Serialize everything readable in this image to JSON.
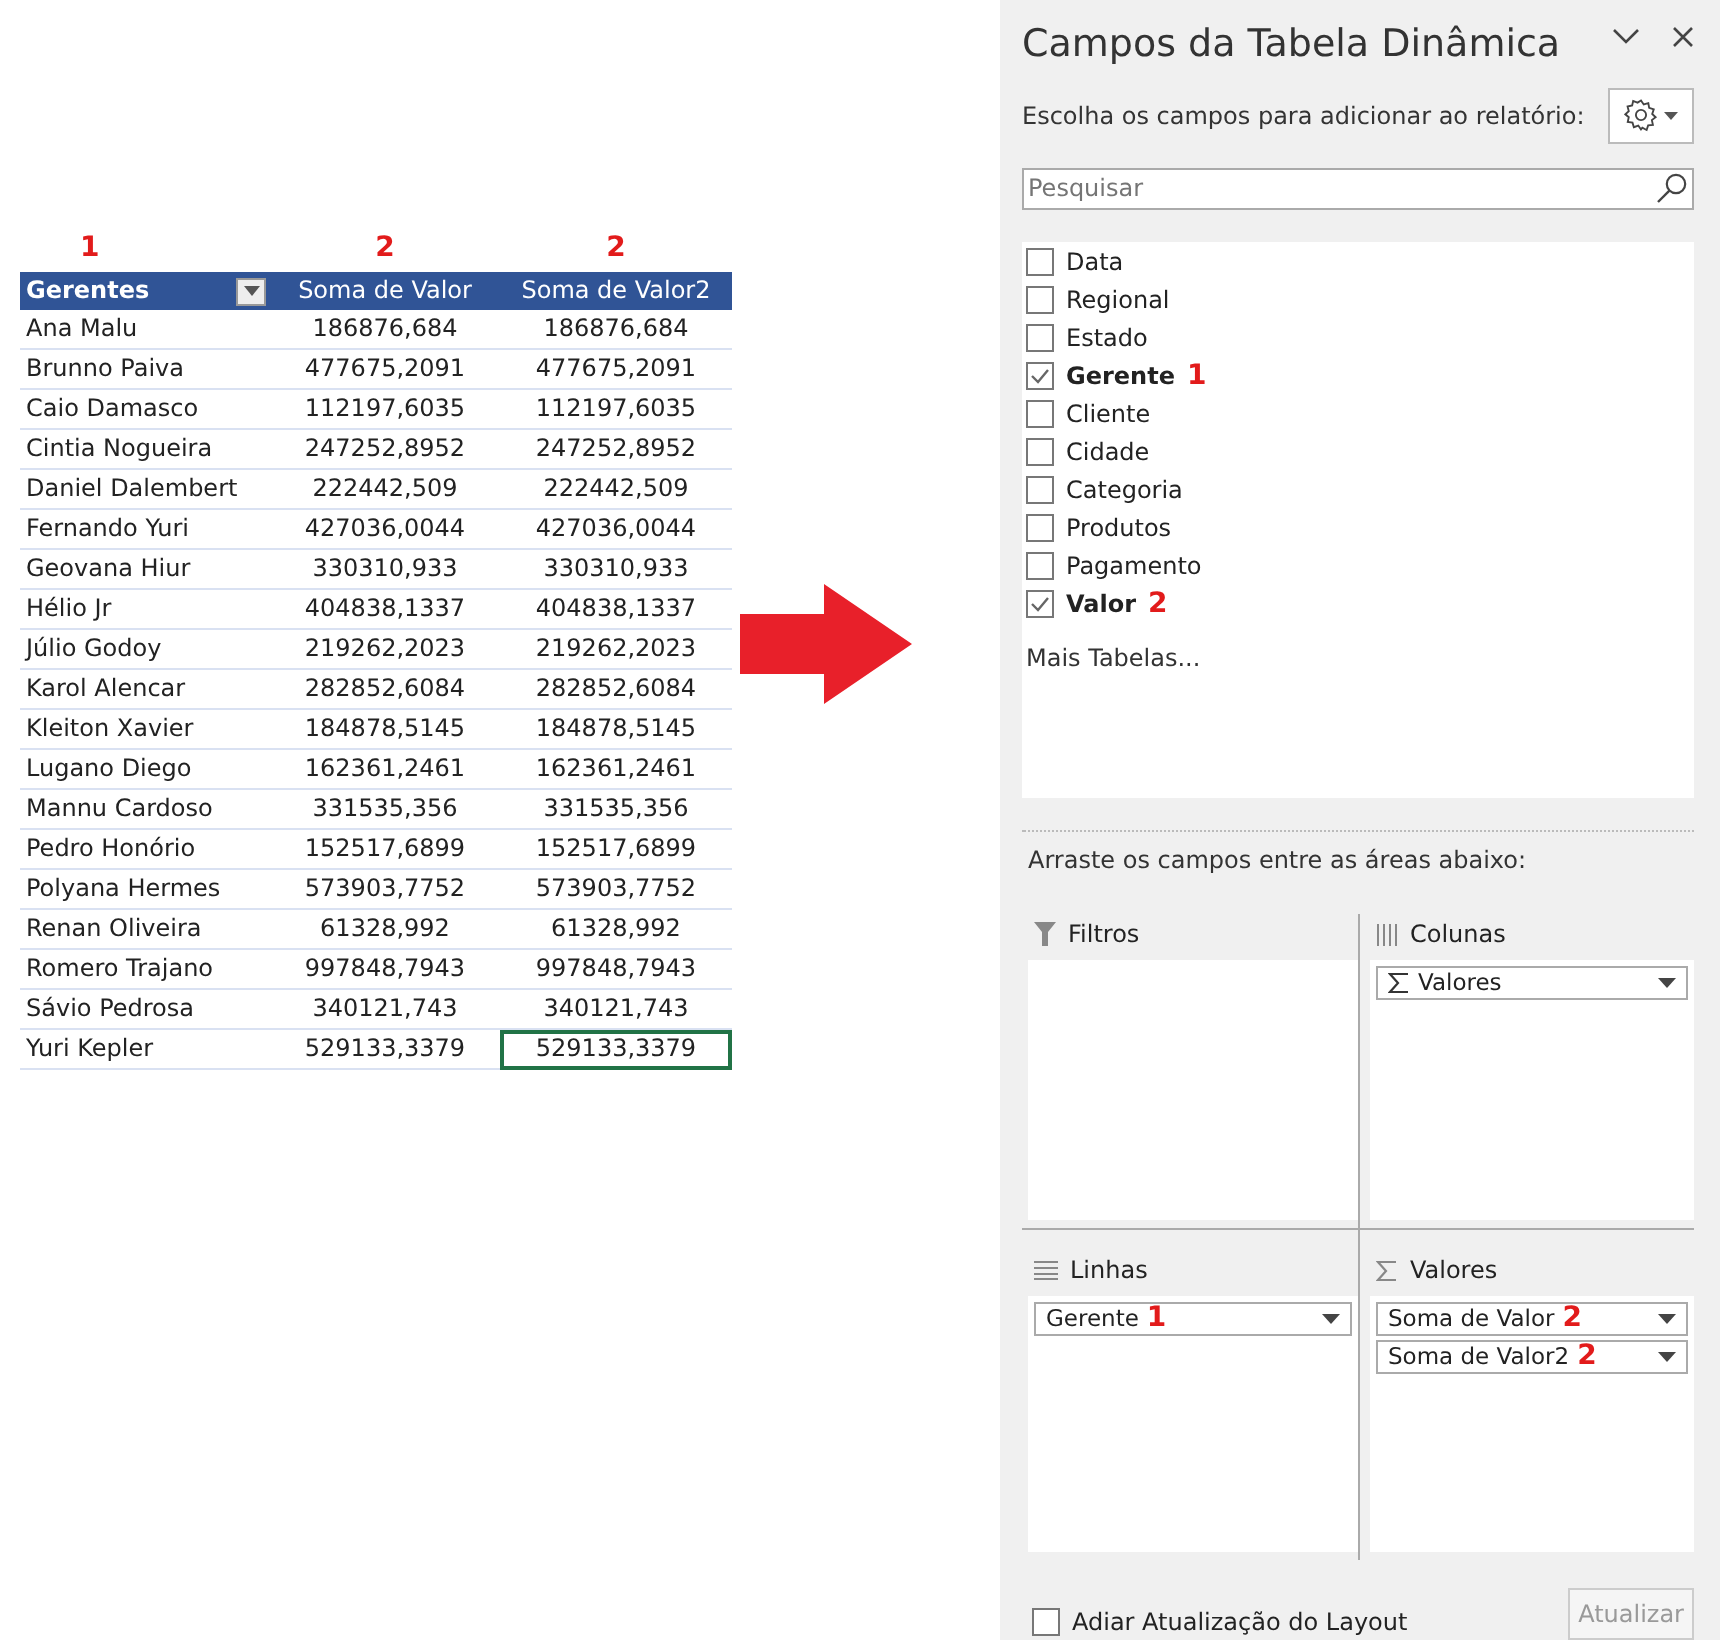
{
  "table": {
    "markers": [
      "1",
      "2",
      "2"
    ],
    "columns": [
      "Gerentes",
      "Soma de Valor",
      "Soma de Valor2"
    ],
    "rows": [
      {
        "cells": [
          {
            "text": "Ana Malu",
            "selected": false
          },
          {
            "text": "186876,684",
            "selected": false
          },
          {
            "text": "186876,684",
            "selected": false
          }
        ]
      },
      {
        "cells": [
          {
            "text": "Brunno Paiva",
            "selected": false
          },
          {
            "text": "477675,2091",
            "selected": false
          },
          {
            "text": "477675,2091",
            "selected": false
          }
        ]
      },
      {
        "cells": [
          {
            "text": "Caio Damasco",
            "selected": false
          },
          {
            "text": "112197,6035",
            "selected": false
          },
          {
            "text": "112197,6035",
            "selected": false
          }
        ]
      },
      {
        "cells": [
          {
            "text": "Cintia Nogueira",
            "selected": false
          },
          {
            "text": "247252,8952",
            "selected": false
          },
          {
            "text": "247252,8952",
            "selected": false
          }
        ]
      },
      {
        "cells": [
          {
            "text": "Daniel Dalembert",
            "selected": false
          },
          {
            "text": "222442,509",
            "selected": false
          },
          {
            "text": "222442,509",
            "selected": false
          }
        ]
      },
      {
        "cells": [
          {
            "text": "Fernando Yuri",
            "selected": false
          },
          {
            "text": "427036,0044",
            "selected": false
          },
          {
            "text": "427036,0044",
            "selected": false
          }
        ]
      },
      {
        "cells": [
          {
            "text": "Geovana Hiur",
            "selected": false
          },
          {
            "text": "330310,933",
            "selected": false
          },
          {
            "text": "330310,933",
            "selected": false
          }
        ]
      },
      {
        "cells": [
          {
            "text": "Hélio Jr",
            "selected": false
          },
          {
            "text": "404838,1337",
            "selected": false
          },
          {
            "text": "404838,1337",
            "selected": false
          }
        ]
      },
      {
        "cells": [
          {
            "text": "Júlio Godoy",
            "selected": false
          },
          {
            "text": "219262,2023",
            "selected": false
          },
          {
            "text": "219262,2023",
            "selected": false
          }
        ]
      },
      {
        "cells": [
          {
            "text": "Karol Alencar",
            "selected": false
          },
          {
            "text": "282852,6084",
            "selected": false
          },
          {
            "text": "282852,6084",
            "selected": false
          }
        ]
      },
      {
        "cells": [
          {
            "text": "Kleiton Xavier",
            "selected": false
          },
          {
            "text": "184878,5145",
            "selected": false
          },
          {
            "text": "184878,5145",
            "selected": false
          }
        ]
      },
      {
        "cells": [
          {
            "text": "Lugano Diego",
            "selected": false
          },
          {
            "text": "162361,2461",
            "selected": false
          },
          {
            "text": "162361,2461",
            "selected": false
          }
        ]
      },
      {
        "cells": [
          {
            "text": "Mannu Cardoso",
            "selected": false
          },
          {
            "text": "331535,356",
            "selected": false
          },
          {
            "text": "331535,356",
            "selected": false
          }
        ]
      },
      {
        "cells": [
          {
            "text": "Pedro Honório",
            "selected": false
          },
          {
            "text": "152517,6899",
            "selected": false
          },
          {
            "text": "152517,6899",
            "selected": false
          }
        ]
      },
      {
        "cells": [
          {
            "text": "Polyana Hermes",
            "selected": false
          },
          {
            "text": "573903,7752",
            "selected": false
          },
          {
            "text": "573903,7752",
            "selected": false
          }
        ]
      },
      {
        "cells": [
          {
            "text": "Renan Oliveira",
            "selected": false
          },
          {
            "text": "61328,992",
            "selected": false
          },
          {
            "text": "61328,992",
            "selected": false
          }
        ]
      },
      {
        "cells": [
          {
            "text": "Romero Trajano",
            "selected": false
          },
          {
            "text": "997848,7943",
            "selected": false
          },
          {
            "text": "997848,7943",
            "selected": false
          }
        ]
      },
      {
        "cells": [
          {
            "text": "Sávio Pedrosa",
            "selected": false
          },
          {
            "text": "340121,743",
            "selected": false
          },
          {
            "text": "340121,743",
            "selected": false
          }
        ]
      },
      {
        "cells": [
          {
            "text": "Yuri Kepler",
            "selected": false
          },
          {
            "text": "529133,3379",
            "selected": false
          },
          {
            "text": "529133,3379",
            "selected": true
          }
        ]
      }
    ]
  },
  "panel": {
    "title": "Campos da Tabela Dinâmica",
    "subtitle": "Escolha os campos para adicionar ao relatório:",
    "search": {
      "placeholder": "Pesquisar"
    },
    "fields": [
      {
        "label": "Data",
        "checked": false
      },
      {
        "label": "Regional",
        "checked": false
      },
      {
        "label": "Estado",
        "checked": false
      },
      {
        "label": "Gerente",
        "checked": true,
        "marker": "1"
      },
      {
        "label": "Cliente",
        "checked": false
      },
      {
        "label": "Cidade",
        "checked": false
      },
      {
        "label": "Categoria",
        "checked": false
      },
      {
        "label": "Produtos",
        "checked": false
      },
      {
        "label": "Pagamento",
        "checked": false
      },
      {
        "label": "Valor",
        "checked": true,
        "marker": "2"
      }
    ],
    "more_tables": "Mais Tabelas...",
    "drag_hint": "Arraste os campos entre as áreas abaixo:",
    "areas": [
      {
        "kind": "filter",
        "title": "Filtros"
      },
      {
        "kind": "columns",
        "title": "Colunas",
        "items": [
          {
            "label": "Valores",
            "kind": "sigma"
          }
        ]
      },
      {
        "kind": "rows",
        "title": "Linhas",
        "items": [
          {
            "label": "Gerente",
            "kind": "field",
            "marker": "1"
          }
        ]
      },
      {
        "kind": "values",
        "title": "Valores",
        "items": [
          {
            "label": "Soma de Valor",
            "kind": "field",
            "marker": "2"
          },
          {
            "label": "Soma de Valor2",
            "kind": "field",
            "marker": "2"
          }
        ]
      }
    ],
    "defer": {
      "label": "Adiar Atualização do Layout",
      "checked": false
    },
    "update_button": {
      "label": "Atualizar",
      "disabled": true
    }
  }
}
